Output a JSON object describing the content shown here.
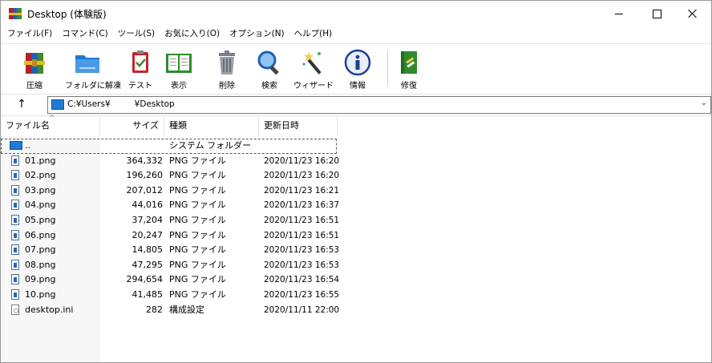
{
  "window": {
    "title": "Desktop (体験版)",
    "controls": {
      "minimize": "minimize-icon",
      "maximize": "maximize-icon",
      "close": "close-icon"
    }
  },
  "menu": [
    {
      "label": "ファイル(F)"
    },
    {
      "label": "コマンド(C)"
    },
    {
      "label": "ツール(S)"
    },
    {
      "label": "お気に入り(O)"
    },
    {
      "label": "オプション(N)"
    },
    {
      "label": "ヘルプ(H)"
    }
  ],
  "toolbar": [
    {
      "label": "圧縮",
      "icon": "archive-books-icon"
    },
    {
      "label": "フォルダに解凍",
      "icon": "extract-folder-icon"
    },
    {
      "label": "テスト",
      "icon": "test-clipboard-icon"
    },
    {
      "label": "表示",
      "icon": "view-book-icon"
    },
    {
      "label": "削除",
      "icon": "trash-icon"
    },
    {
      "label": "検索",
      "icon": "magnifier-icon"
    },
    {
      "label": "ウィザード",
      "icon": "wizard-wand-icon"
    },
    {
      "label": "情報",
      "icon": "info-icon"
    },
    {
      "label": "修復",
      "icon": "repair-kit-icon"
    }
  ],
  "address": {
    "path": "C:¥Users¥         ¥Desktop",
    "up_glyph": "↑",
    "dropdown_glyph": "⌄"
  },
  "columns": {
    "name": "ファイル名",
    "size": "サイズ",
    "type": "種類",
    "modified": "更新日時"
  },
  "files": [
    {
      "name": "..",
      "size": "",
      "type": "システム フォルダー",
      "modified": "",
      "icon": "folder"
    },
    {
      "name": "01.png",
      "size": "364,332",
      "type": "PNG ファイル",
      "modified": "2020/11/23 16:20",
      "icon": "png"
    },
    {
      "name": "02.png",
      "size": "196,260",
      "type": "PNG ファイル",
      "modified": "2020/11/23 16:20",
      "icon": "png"
    },
    {
      "name": "03.png",
      "size": "207,012",
      "type": "PNG ファイル",
      "modified": "2020/11/23 16:21",
      "icon": "png"
    },
    {
      "name": "04.png",
      "size": "44,016",
      "type": "PNG ファイル",
      "modified": "2020/11/23 16:37",
      "icon": "png"
    },
    {
      "name": "05.png",
      "size": "37,204",
      "type": "PNG ファイル",
      "modified": "2020/11/23 16:51",
      "icon": "png"
    },
    {
      "name": "06.png",
      "size": "20,247",
      "type": "PNG ファイル",
      "modified": "2020/11/23 16:51",
      "icon": "png"
    },
    {
      "name": "07.png",
      "size": "14,805",
      "type": "PNG ファイル",
      "modified": "2020/11/23 16:53",
      "icon": "png"
    },
    {
      "name": "08.png",
      "size": "47,295",
      "type": "PNG ファイル",
      "modified": "2020/11/23 16:53",
      "icon": "png"
    },
    {
      "name": "09.png",
      "size": "294,654",
      "type": "PNG ファイル",
      "modified": "2020/11/23 16:54",
      "icon": "png"
    },
    {
      "name": "10.png",
      "size": "41,485",
      "type": "PNG ファイル",
      "modified": "2020/11/23 16:55",
      "icon": "png"
    },
    {
      "name": "desktop.ini",
      "size": "282",
      "type": "構成設定",
      "modified": "2020/11/11 22:00",
      "icon": "ini"
    }
  ]
}
